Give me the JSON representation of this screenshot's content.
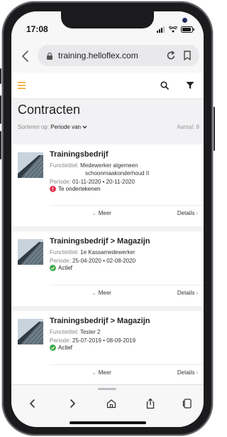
{
  "status_bar": {
    "time": "17:08"
  },
  "browser": {
    "url": "training.helloflex.com"
  },
  "page": {
    "title": "Contracten",
    "sort_label": "Sorteren op:",
    "sort_value": "Periode van",
    "count_label": "Aantal: 8"
  },
  "labels": {
    "function": "Functietitel:",
    "period": "Periode:",
    "more": "Meer",
    "details": "Details"
  },
  "contracts": [
    {
      "title": "Trainingsbedrijf",
      "function_line1": "Medewerker algemeen",
      "function_line2": "schoonmaakonderhoud II",
      "period": "01-11-2020 • 20-11-2020",
      "status": "Te ondertekenen",
      "status_color": "#e0334e"
    },
    {
      "title": "Trainingsbedrijf > Magazijn",
      "function_line1": "1e Kassamedewerker",
      "period": "25-04-2020 • 02-08-2020",
      "status": "Actief",
      "status_color": "#3aa745"
    },
    {
      "title": "Trainingsbedrijf > Magazijn",
      "function_line1": "Tester 2",
      "period": "25-07-2019 • 08-09-2019",
      "status": "Actief",
      "status_color": "#3aa745"
    }
  ],
  "colors": {
    "accent": "#f5a623",
    "danger": "#e0334e",
    "success": "#3aa745"
  },
  "icons": [
    "back-icon",
    "lock-icon",
    "reload-icon",
    "bookmark-icon",
    "menu-icon",
    "search-icon",
    "filter-icon",
    "chevron-down-icon",
    "chevron-right-icon",
    "forward-icon",
    "home-icon",
    "share-icon",
    "tabs-icon"
  ]
}
